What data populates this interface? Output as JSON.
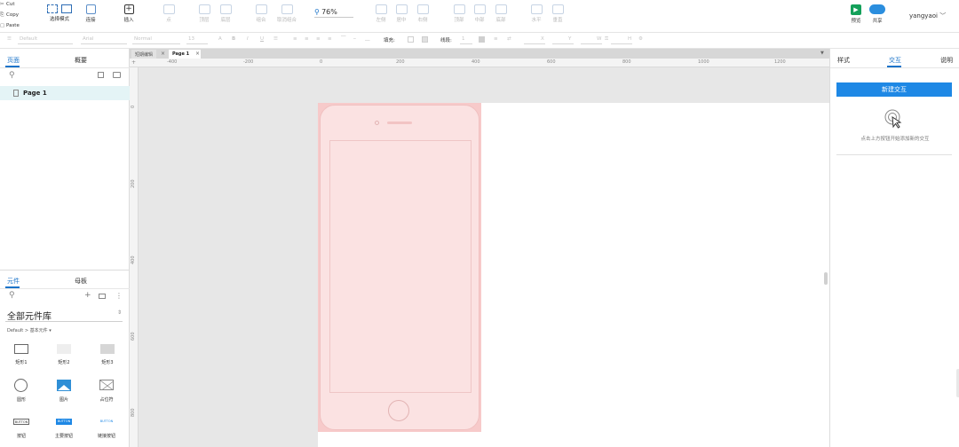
{
  "clipboard": {
    "cut": "Cut",
    "copy": "Copy",
    "paste": "Paste"
  },
  "toolbar": {
    "select_mode": "选择模式",
    "connect": "连接",
    "insert": "插入",
    "point": "点",
    "top_layer": "顶层",
    "bottom_layer": "底层",
    "group": "组合",
    "ungroup": "取消组合",
    "zoom": "76%",
    "align_left": "左侧",
    "align_center": "居中",
    "align_right": "右侧",
    "align_top": "顶部",
    "align_middle": "中部",
    "align_bottom": "底部",
    "horizontal": "水平",
    "vertical": "垂直",
    "preview": "预览",
    "share": "共享",
    "username": "yangyaoi"
  },
  "formatbar": {
    "style": "Default",
    "font": "Arial",
    "weight": "Normal",
    "size": "13",
    "fill_label": "填充:",
    "line_label": "线段:",
    "line_value": "1",
    "x_label": "X",
    "y_label": "Y",
    "w_label": "W",
    "h_label": "H"
  },
  "left_panel": {
    "tab_pages": "页面",
    "tab_outline": "概要",
    "page_item": "Page 1",
    "tab_widgets": "元件",
    "tab_masters": "母板",
    "library": "全部元件库",
    "breadcrumb": "Default > 基本元件 ▾",
    "widgets": [
      {
        "label": "矩形1"
      },
      {
        "label": "矩形2"
      },
      {
        "label": "矩形3"
      },
      {
        "label": "圆形"
      },
      {
        "label": "图片"
      },
      {
        "label": "占位符"
      },
      {
        "label": "按钮",
        "chip": "BUTTON"
      },
      {
        "label": "主要按钮",
        "chip": "BUTTON"
      },
      {
        "label": "链接按钮",
        "chip": "BUTTON"
      }
    ]
  },
  "canvas": {
    "tab_inactive": "短期编辑",
    "tab_active": "Page 1",
    "ruler_h": [
      "-400",
      "-200",
      "0",
      "200",
      "400",
      "600",
      "800",
      "1000",
      "1200"
    ],
    "ruler_v": [
      "0",
      "200",
      "400",
      "600",
      "800"
    ]
  },
  "right_panel": {
    "tab_style": "样式",
    "tab_interaction": "交互",
    "tab_notes": "说明",
    "new_interaction": "新建交互",
    "hint": "点击上方按钮开始添加新的交互"
  },
  "colors": {
    "accent": "#1a73c9",
    "button": "#1e88e5",
    "phone_fill": "#fbe2e2",
    "phone_outer": "#f7caca",
    "preview_green": "#14a05a",
    "share_blue": "#2b8ede"
  }
}
